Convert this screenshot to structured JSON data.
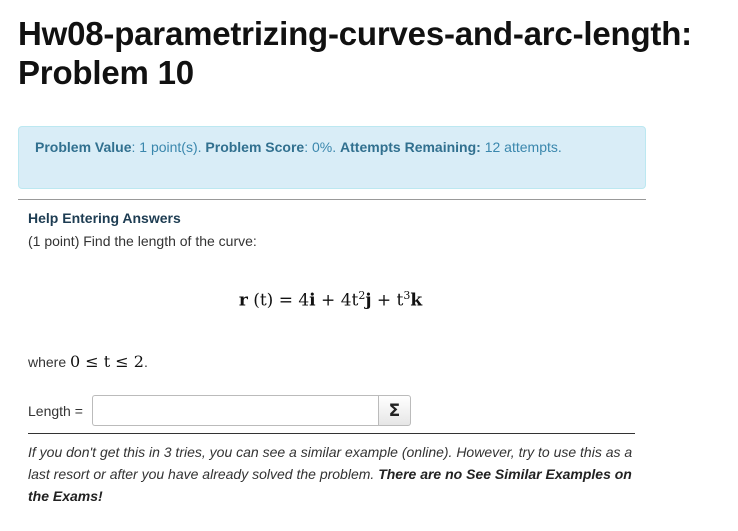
{
  "page": {
    "title": "Hw08-parametrizing-curves-and-arc-length: Problem 10"
  },
  "problem_info": {
    "value_label": "Problem Value",
    "value_text": ": 1 point(s). ",
    "score_label": "Problem Score",
    "score_text": ": 0%. ",
    "attempts_label": "Attempts Remaining:",
    "attempts_text": " 12 attempts."
  },
  "problem": {
    "help_link": "Help Entering Answers",
    "intro": "(1 point) Find the length of the curve:",
    "equation": {
      "lhs": "r",
      "arg": " (t) = 4",
      "i": "i",
      "mid1": " + 4t",
      "exp1": "2",
      "j": "j",
      "mid2": " + t",
      "exp2": "3",
      "k": "k"
    },
    "where_prefix": "where ",
    "where_math": "0 ≤ t ≤ 2",
    "where_suffix": "."
  },
  "answer": {
    "label": "Length =",
    "value": "",
    "placeholder": "",
    "sigma_glyph": "Σ"
  },
  "footer": {
    "note": "If you don't get this in 3 tries, you can see a similar example (online). However, try to use this as a last resort or after you have already solved the problem. ",
    "note_bold": "There are no See Similar Examples on the Exams!"
  }
}
